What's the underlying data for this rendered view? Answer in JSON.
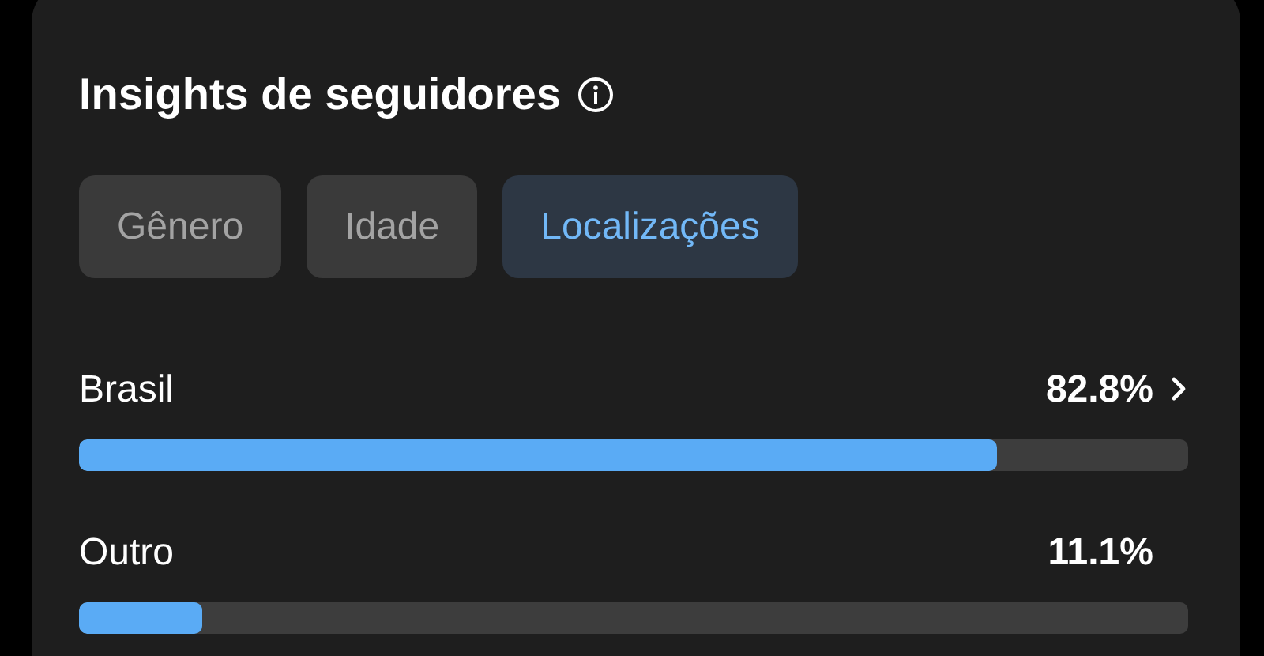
{
  "card": {
    "title": "Insights de seguidores"
  },
  "tabs": [
    {
      "label": "Gênero",
      "selected": false
    },
    {
      "label": "Idade",
      "selected": false
    },
    {
      "label": "Localizações",
      "selected": true
    }
  ],
  "locations": [
    {
      "name": "Brasil",
      "percent": "82.8%",
      "level": 0.828,
      "has_details": true
    },
    {
      "name": "Outro",
      "percent": "11.1%",
      "level": 0.111,
      "has_details": false
    }
  ]
}
